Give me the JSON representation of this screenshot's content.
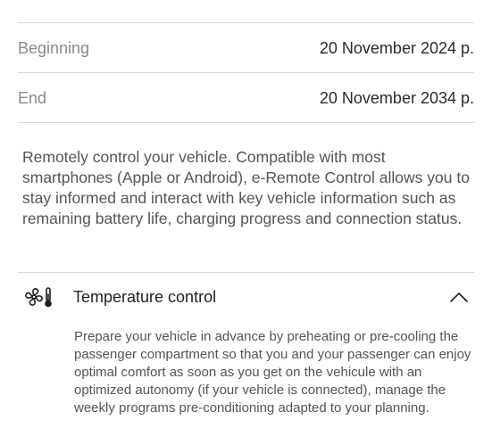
{
  "dates": {
    "beginning_label": "Beginning",
    "beginning_value": "20 November 2024 p.",
    "end_label": "End",
    "end_value": "20 November 2034 p."
  },
  "description": "Remotely control your vehicle. Compatible with most smartphones (Apple or Android), e-Remote Control allows you to stay informed and interact with key vehicle information such as remaining battery life, charging progress and connection status.",
  "accordion": {
    "title": "Temperature control",
    "icon": "fan-thermometer-icon",
    "expanded": true,
    "body": "Prepare your vehicle in advance by preheating or pre-cooling the passenger compartment so that you and your passenger can enjoy optimal comfort as soon as you get on the vehicule with an optimized autonomy (if your vehicle is connected), manage the weekly programs pre-conditioning adapted to your planning."
  }
}
